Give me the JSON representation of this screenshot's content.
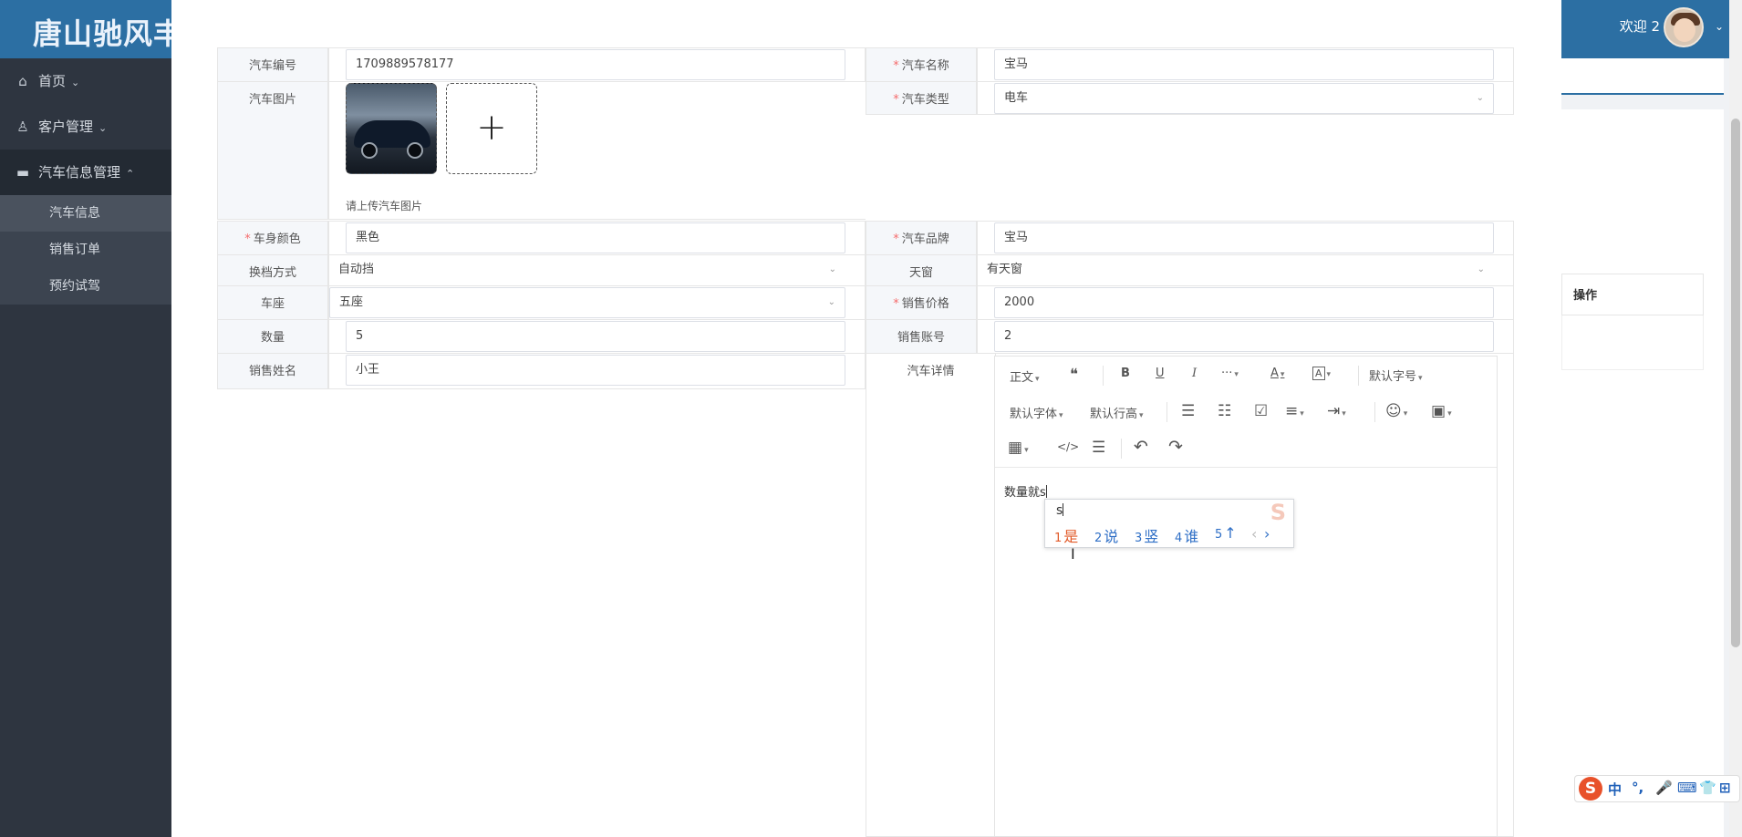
{
  "app": {
    "brand": "唐山驰风丰",
    "welcome": "欢迎 2"
  },
  "sidebar": {
    "items": [
      {
        "label": "首页",
        "icon": "home-icon"
      },
      {
        "label": "客户管理",
        "icon": "user-icon"
      },
      {
        "label": "汽车信息管理",
        "icon": "list-icon"
      }
    ],
    "sub_items": [
      {
        "label": "汽车信息"
      },
      {
        "label": "销售订单"
      },
      {
        "label": "预约试驾"
      }
    ]
  },
  "background": {
    "column_header": "操作"
  },
  "form": {
    "car_no_label": "汽车编号",
    "car_no_value": "1709889578177",
    "car_name_label": "汽车名称",
    "car_name_value": "宝马",
    "car_image_label": "汽车图片",
    "upload_hint": "请上传汽车图片",
    "upload_plus": "+",
    "car_type_label": "汽车类型",
    "car_type_value": "电车",
    "body_color_label": "车身颜色",
    "body_color_value": "黑色",
    "car_brand_label": "汽车品牌",
    "car_brand_value": "宝马",
    "gear_label": "换档方式",
    "gear_value": "自动挡",
    "sunroof_label": "天窗",
    "sunroof_value": "有天窗",
    "seat_label": "车座",
    "seat_value": "五座",
    "price_label": "销售价格",
    "price_value": "2000",
    "qty_label": "数量",
    "qty_value": "5",
    "account_label": "销售账号",
    "account_value": "2",
    "seller_label": "销售姓名",
    "seller_value": "小王",
    "detail_label": "汽车详情"
  },
  "editor": {
    "toolbar": {
      "paragraph": "正文",
      "quote": "❝",
      "bold": "B",
      "underline": "U",
      "italic": "I",
      "more": "···",
      "font_color": "A",
      "bg_color": "A",
      "font_size": "默认字号",
      "font_family": "默认字体",
      "line_height": "默认行高",
      "bullet": "☰",
      "numbered": "☷",
      "todo": "☑",
      "align": "≡",
      "indent": "⇥",
      "emoji": "☺",
      "image": "▣",
      "table": "▦",
      "code": "</>",
      "divider": "☰",
      "undo": "↶",
      "redo": "↷"
    },
    "content": "数量就s"
  },
  "ime": {
    "typed": "s",
    "candidates": [
      {
        "num": "1",
        "text": "是"
      },
      {
        "num": "2",
        "text": "说"
      },
      {
        "num": "3",
        "text": "竖"
      },
      {
        "num": "4",
        "text": "谁"
      },
      {
        "num": "5",
        "text": "↑"
      }
    ],
    "prev": "‹",
    "next": "›",
    "logo": "S"
  },
  "ime_bar": {
    "logo": "S",
    "mode": "中",
    "punct": "°,",
    "mic": "🎤",
    "keyboard": "⌨",
    "skin": "👕",
    "grid": "⊞"
  }
}
